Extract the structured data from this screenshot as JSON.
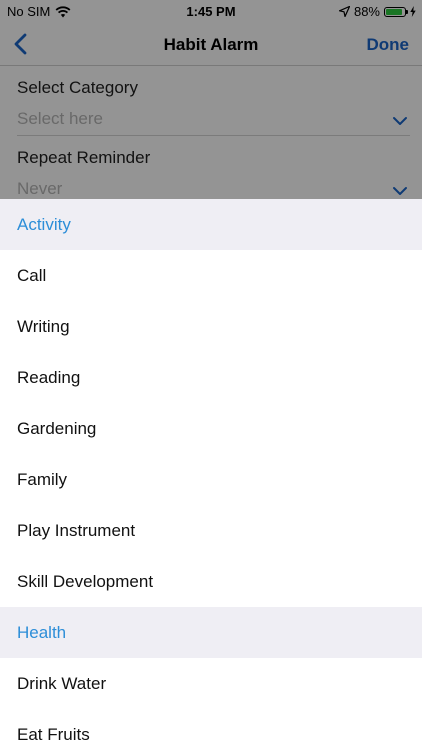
{
  "status_bar": {
    "carrier": "No SIM",
    "time": "1:45 PM",
    "battery_percent": "88%",
    "battery_level": 0.88,
    "icons": [
      "wifi-icon",
      "location-arrow-icon",
      "battery-icon",
      "charging-bolt-icon"
    ]
  },
  "nav": {
    "title": "Habit Alarm",
    "done_label": "Done",
    "back_icon": "chevron-left-icon"
  },
  "form": {
    "category": {
      "label": "Select Category",
      "placeholder": "Select here"
    },
    "repeat": {
      "label": "Repeat Reminder",
      "value": "Never"
    }
  },
  "picker": {
    "rows": [
      {
        "type": "header",
        "label": "Activity"
      },
      {
        "type": "item",
        "label": "Call"
      },
      {
        "type": "item",
        "label": "Writing"
      },
      {
        "type": "item",
        "label": "Reading"
      },
      {
        "type": "item",
        "label": "Gardening"
      },
      {
        "type": "item",
        "label": "Family"
      },
      {
        "type": "item",
        "label": "Play Instrument"
      },
      {
        "type": "item",
        "label": "Skill Development"
      },
      {
        "type": "header",
        "label": "Health"
      },
      {
        "type": "item",
        "label": "Drink Water"
      },
      {
        "type": "item",
        "label": "Eat Fruits"
      }
    ]
  },
  "colors": {
    "accent": "#1a64c8",
    "section_header_text": "#2d8ed8",
    "section_header_bg": "#efeef4",
    "battery": "#2ecc40"
  }
}
